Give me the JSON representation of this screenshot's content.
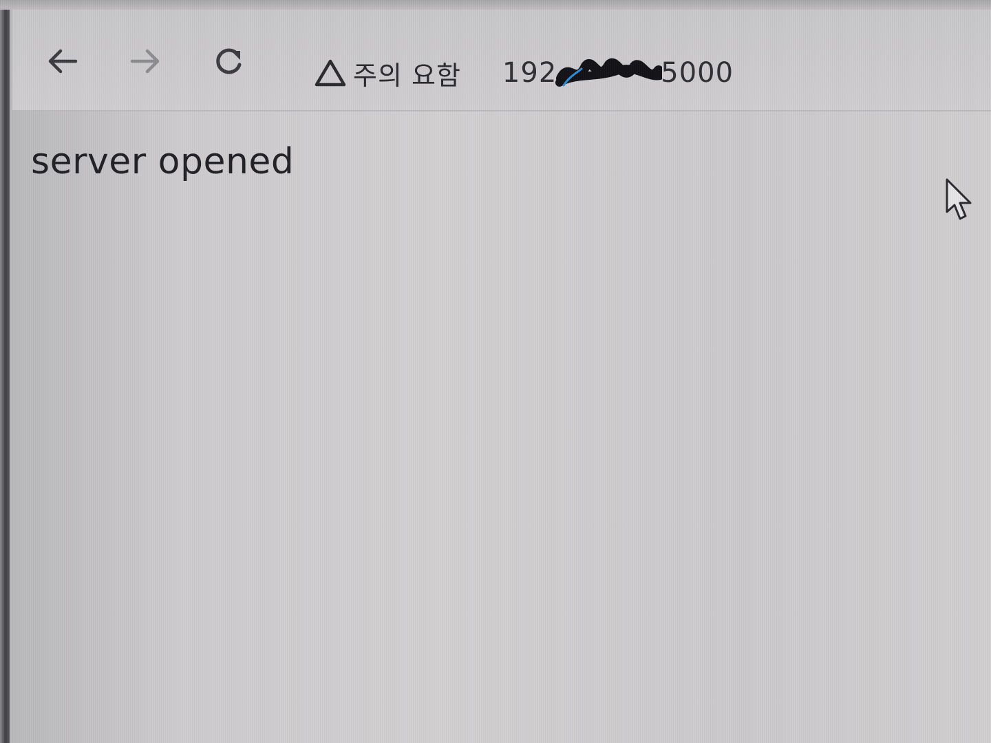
{
  "browser": {
    "security_label": "주의 요함",
    "url_prefix": "192",
    "url_suffix": "5000",
    "icons": {
      "back": "arrow-left-icon",
      "forward": "arrow-right-icon",
      "reload": "reload-icon",
      "security": "warning-triangle-icon"
    }
  },
  "page": {
    "body_text": "server opened"
  },
  "colors": {
    "text": "#1f1f24",
    "icon": "#3a3a3f",
    "icon_disabled": "#8d8c90",
    "redaction": "#121216",
    "redaction_accent": "#2c8fd6"
  }
}
